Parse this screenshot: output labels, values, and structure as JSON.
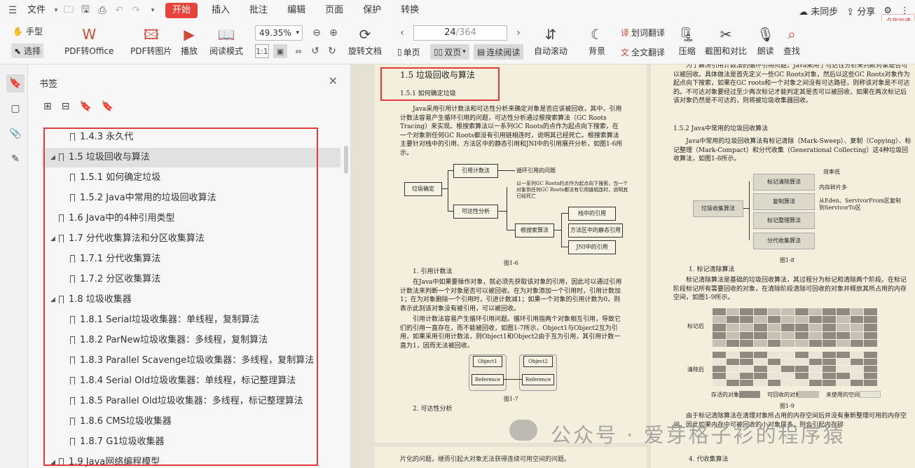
{
  "menubar": {
    "file_label": "文件",
    "tabs": [
      {
        "label": "开始",
        "active": true
      },
      {
        "label": "插入"
      },
      {
        "label": "批注"
      },
      {
        "label": "编辑"
      },
      {
        "label": "页面"
      },
      {
        "label": "保护"
      },
      {
        "label": "转换"
      }
    ],
    "sync_label": "未同步",
    "share_label": "分享",
    "badge_label": "点我加速"
  },
  "toolbar": {
    "hand": "手型",
    "select": "选择",
    "pdf_to_office": "PDF转Office",
    "pdf_to_image": "PDF转图片",
    "play": "播放",
    "reading_mode": "阅读模式",
    "zoom": "49.35%",
    "rotate_doc": "旋转文档",
    "page_current": "24",
    "page_total": "/364",
    "single_page": "单页",
    "double_page": "双页",
    "continuous": "连续阅读",
    "auto_scroll": "自动滚动",
    "background": "背景",
    "word_translate": "划词翻译",
    "full_translate": "全文翻译",
    "compress": "压缩",
    "screenshot_compare": "截图和对比",
    "read_aloud": "朗读",
    "search": "查找"
  },
  "panel": {
    "title": "书签",
    "items": [
      {
        "label": "1.4.3 永久代",
        "level": 2
      },
      {
        "label": "1.5 垃圾回收与算法",
        "level": 1,
        "expanded": true,
        "selected": true
      },
      {
        "label": "1.5.1 如何确定垃圾",
        "level": 2
      },
      {
        "label": "1.5.2 Java中常用的垃圾回收算法",
        "level": 2
      },
      {
        "label": "1.6 Java中的4种引用类型",
        "level": 1
      },
      {
        "label": "1.7 分代收集算法和分区收集算法",
        "level": 1,
        "expanded": true
      },
      {
        "label": "1.7.1 分代收集算法",
        "level": 2
      },
      {
        "label": "1.7.2 分区收集算法",
        "level": 2
      },
      {
        "label": "1.8 垃圾收集器",
        "level": 1,
        "expanded": true
      },
      {
        "label": "1.8.1 Serial垃圾收集器：单线程，复制算法",
        "level": 2
      },
      {
        "label": "1.8.2 ParNew垃圾收集器：多线程，复制算法",
        "level": 2
      },
      {
        "label": "1.8.3 Parallel Scavenge垃圾收集器：多线程，复制算法",
        "level": 2
      },
      {
        "label": "1.8.4 Serial Old垃圾收集器：单线程，标记整理算法",
        "level": 2
      },
      {
        "label": "1.8.5 Parallel Old垃圾收集器：多线程，标记整理算法",
        "level": 2
      },
      {
        "label": "1.8.6 CMS垃圾收集器",
        "level": 2
      },
      {
        "label": "1.8.7 G1垃圾收集器",
        "level": 2
      },
      {
        "label": "1.9 Java网络编程模型",
        "level": 1,
        "expanded": true
      }
    ]
  },
  "doc": {
    "left": {
      "h1": "1.5 垃圾回收与算法",
      "h2": "1.5.1 如何确定垃圾",
      "para1": "Java采用引用计数法和可达性分析来确定对象是否应该被回收，其中，引用计数法容易产生循环引用的问题，可达性分析通过根搜索算法（GC Roots Tracing）来实现。根搜索算法以一系列GC Roots的点作为起点向下搜索，在一个对象到任何GC Roots都没有引用链相连时，说明其已经死亡。根搜索算法主要针对栈中的引用、方法区中的静态引用和JNI中的引用展开分析，如图1-6所示。",
      "d_root": "垃圾确定",
      "d_ref": "引用计数法",
      "d_circ": "循环引用的问题",
      "d_reach": "可达性分析",
      "d_note": "以一系列GC Roots的点作为起点向下搜索，当一个对象到任何GC Roots都没有引用链相连时，说明其已经死亡",
      "d_rootsearch": "根搜索算法",
      "d_stack": "栈中的引用",
      "d_static": "方法区中的静态引用",
      "d_jni": "JNI中的引用",
      "fig6": "图1-6",
      "s1": "1. 引用计数法",
      "para2": "在Java中如果要操作对象，就必须先获取该对象的引用，因此可以通过引用计数法来判断一个对象是否可以被回收。在为对象添加一个引用时，引用计数加1；在为对象删除一个引用时，引进计数减1；如果一个对象的引用计数为0，则表示此刻该对象没有被引用，可以被回收。",
      "para3": "引用计数法容易产生循环引用问题。循环引用指两个对象相互引用，导致它们的引用一直存在，而不能被回收，如图1-7所示，Object1与Object2互为引用，如果采用引用计数法，则Object1和Object2由于互为引用，其引用计数一直为1，因而无法被回收。",
      "obj1": "Object1",
      "obj2": "Object2",
      "refa": "Reference",
      "refb": "Reference",
      "fig7": "图1-7",
      "s2": "2. 可达性分析",
      "bottom": "片化的问题，继而引起大对象无法获得连续可用空间的问题。"
    },
    "right": {
      "para0": "为了解决引用计数法的循环引用问题，Java采用了可达性分析来判断对象是否可以被回收。具体做法是首先定义一些GC Roots对象，然后以这些GC Roots对象作为起点向下搜索，如果在GC roots和一个对象之间没有可达路径，则称该对象是不可达的。不可达对象要经过至少两次标记才能判定其是否可以被回收，如果在两次标记后该对象仍然是不可达的，则将被垃圾收集器回收。",
      "h2": "1.5.2 Java中常用的垃圾回收算法",
      "para1": "Java中常用的垃圾回收算法有标记清除（Mark-Sweep）、复制（Copying）、标记整理（Mark-Compact）和分代收集（Generational Collecting）这4种垃圾回收算法，如图1-8所示。",
      "d_root": "垃圾收集算法",
      "d_ms": "标记清除算法",
      "d_cp": "复制算法",
      "d_mc": "标记整理算法",
      "d_gen": "分代收集算法",
      "d_eff": "效率低",
      "d_frag": "内存碎片多",
      "d_eden": "从Eden、ServivorFrom区复制到ServivorTo区",
      "fig8": "图1-8",
      "s1": "1. 标记清除算法",
      "para2": "标记清除算法是基础的垃圾回收算法，其过程分为标记和清除两个阶段。在标记阶段标记所有需要回收的对象，在清除阶段清除可回收的对象并释放其所占用的内存空间，如图1-9所示。",
      "lbl_marked": "标记后",
      "lbl_cleared": "清除后",
      "leg_alive": "存活的对象",
      "leg_recyc": "可回收的对象",
      "leg_unused": "未使用的空间",
      "fig9": "图1-9",
      "para3": "由于标记清除算法在清理对象所占用的内存空间后并没有重新整理可用的内存空间，因此如果内存中可被回收的小对象居多，则会引起内存碎",
      "s_copy": "4. 代收集算法"
    },
    "watermark": "公众号 · 爱芽格子衫的程序猿"
  }
}
